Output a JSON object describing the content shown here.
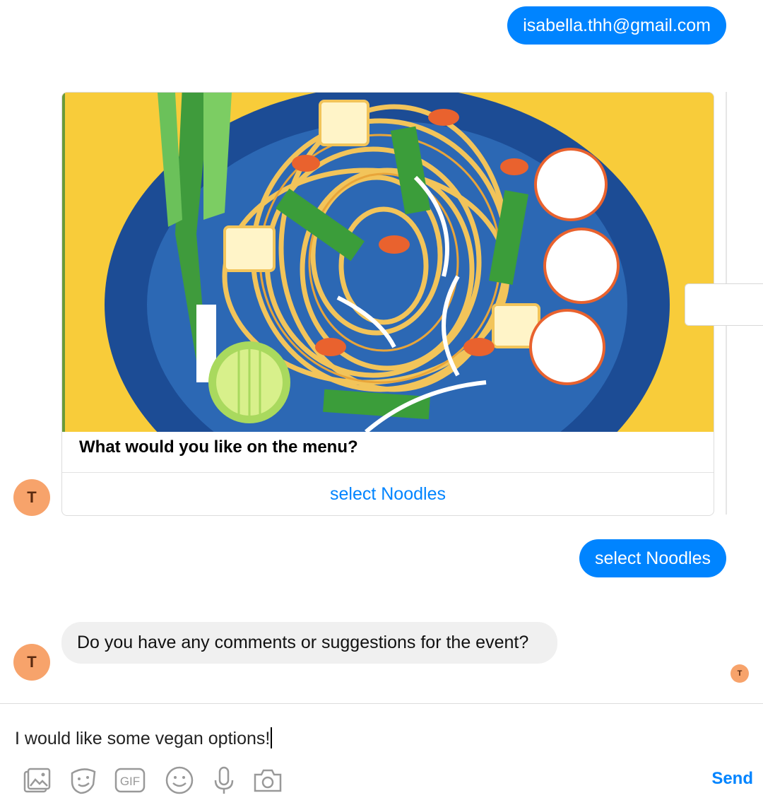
{
  "messages": {
    "user_email": "isabella.thh@gmail.com",
    "user_reply": "select Noodles",
    "bot_question": "Do you have any comments or suggestions for the event?"
  },
  "card": {
    "title": "What would you like on the menu?",
    "button_label": "select Noodles",
    "image_icon": "pad-thai-noodles-illustration"
  },
  "avatar": {
    "initial": "T",
    "color": "#f7a36b"
  },
  "composer": {
    "text": "I would like some vegan options!",
    "send_label": "Send",
    "tools": [
      "photo-icon",
      "sticker-icon",
      "gif-icon",
      "emoji-icon",
      "microphone-icon",
      "camera-icon"
    ],
    "gif_label": "GIF"
  },
  "colors": {
    "accent": "#0084ff",
    "bubble_incoming": "#f0f0f0"
  }
}
